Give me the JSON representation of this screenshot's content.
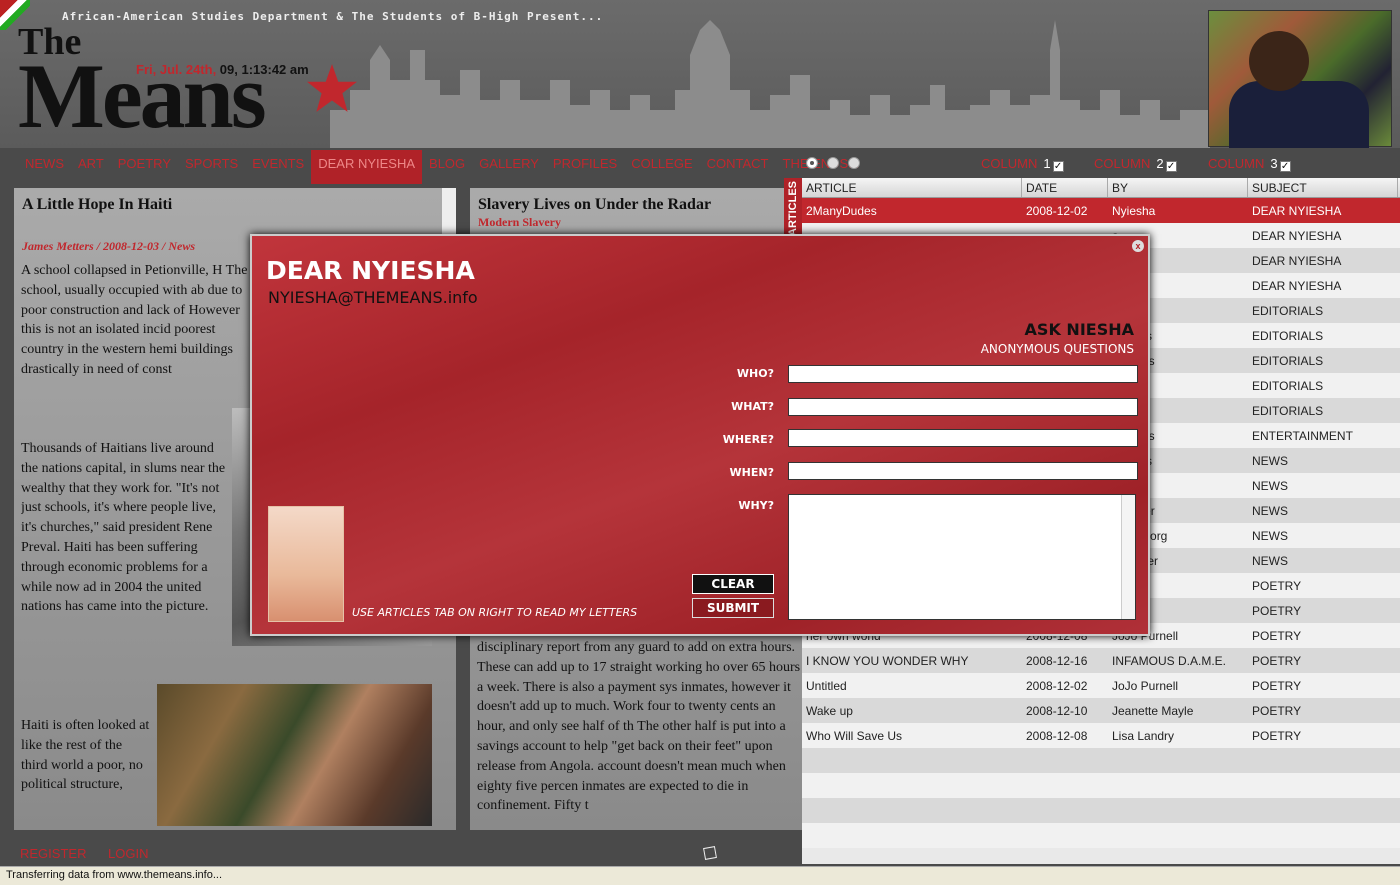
{
  "header": {
    "tagline": "African-American Studies Department & The Students of B-High Present...",
    "logo_the": "The",
    "logo_means": "Means",
    "date_red": "Fri, Jul. 24th,",
    "date_rest": " 09, 1:13:42 am"
  },
  "nav": {
    "items": [
      "NEWS",
      "ART",
      "POETRY",
      "SPORTS",
      "EVENTS",
      "DEAR NYIESHA",
      "BLOG",
      "GALLERY",
      "PROFILES",
      "COLLEGE",
      "CONTACT",
      "THE ENDS..."
    ],
    "columns": [
      {
        "label": "COLUMN",
        "num": "1"
      },
      {
        "label": "COLUMN",
        "num": "2"
      },
      {
        "label": "COLUMN",
        "num": "3"
      }
    ]
  },
  "article1": {
    "title": "A Little Hope In Haiti",
    "byline": "James Metters / 2008-12-03 / News",
    "para1": "A school collapsed  in  Petionville, H The school, usually occupied with ab due to poor construction and lack of However this is not an isolated incid poorest country in the western hemi buildings drastically in need of const",
    "para2": "Thousands of Haitians live around the nations capital, in slums near the wealthy that they work for. \"It's not just schools, it's where people live, it's churches,\" said president Rene Preval. Haiti has been suffering through economic problems for a while now ad in 2004 the united nations has came into the picture.",
    "para3": "Haiti is often looked at like the rest of the third world a poor, no political structure,"
  },
  "article2": {
    "title": "Slavery Lives on Under the Radar",
    "subtitle": "Modern Slavery",
    "para": "disciplinary report from any guard to add on extra hours.  These can add up to 17 straight working ho over 65 hours a week.  There is also a payment sys inmates, however it doesn't add up to much.  Work four to twenty cents an hour, and only see half of th The other half is put into a savings account to help \"get back on their feet\" upon release from Angola. account doesn't mean much when eighty five percen inmates are expected to die in confinement.  Fifty t"
  },
  "table": {
    "side_tab": "ARTICLES",
    "headers": [
      "ARTICLE",
      "DATE",
      "BY",
      "SUBJECT"
    ],
    "rows": [
      [
        "2ManyDudes",
        "2008-12-02",
        "Nyiesha",
        "DEAR NYIESHA"
      ],
      [
        "",
        "",
        "a",
        "DEAR NYIESHA"
      ],
      [
        "",
        "",
        "a",
        "DEAR NYIESHA"
      ],
      [
        "",
        "",
        "a",
        "DEAR NYIESHA"
      ],
      [
        "",
        "",
        "Spivey",
        "EDITORIALS"
      ],
      [
        "",
        "",
        "metters",
        "EDITORIALS"
      ],
      [
        "",
        "",
        "Gilliams",
        "EDITORIALS"
      ],
      [
        "",
        "",
        "ith",
        "EDITORIALS"
      ],
      [
        "",
        "",
        "uyen",
        "EDITORIALS"
      ],
      [
        "",
        "",
        "Gilliams",
        "ENTERTAINMENT"
      ],
      [
        "",
        "",
        "Metters",
        "NEWS"
      ],
      [
        "",
        "",
        "na",
        "NEWS"
      ],
      [
        "",
        "",
        "Gaebler",
        "NEWS"
      ],
      [
        "",
        "",
        ". Ginsborg",
        "NEWS"
      ],
      [
        "",
        "",
        "a Tucker",
        "NEWS"
      ],
      [
        "",
        "",
        "rnell",
        "POETRY"
      ],
      [
        "",
        "",
        "Allen",
        "POETRY"
      ],
      [
        "her own world",
        "2008-12-08",
        "JoJo Purnell",
        "POETRY"
      ],
      [
        "I KNOW YOU WONDER WHY",
        "2008-12-16",
        "INFAMOUS D.A.M.E.",
        "POETRY"
      ],
      [
        "Untitled",
        "2008-12-02",
        "JoJo Purnell",
        "POETRY"
      ],
      [
        "Wake up",
        "2008-12-10",
        "Jeanette Mayle",
        "POETRY"
      ],
      [
        "Who Will Save Us",
        "2008-12-08",
        "Lisa Landry",
        "POETRY"
      ],
      [
        "",
        "",
        "",
        ""
      ],
      [
        "",
        "",
        "",
        ""
      ],
      [
        "",
        "",
        "",
        ""
      ],
      [
        "",
        "",
        "",
        ""
      ]
    ]
  },
  "modal": {
    "title": "DEAR NYIESHA",
    "email": "NYIESHA@THEMEANS.info",
    "ask": "ASK NIESHA",
    "anon": "ANONYMOUS QUESTIONS",
    "labels": [
      "WHO?",
      "WHAT?",
      "WHERE?",
      "WHEN?",
      "WHY?"
    ],
    "clear": "CLEAR",
    "submit": "SUBMIT",
    "hint": "USE ARTICLES TAB ON RIGHT TO READ MY LETTERS",
    "close": "x"
  },
  "footer": {
    "register": "REGISTER",
    "login": "LOGIN",
    "status": "Transferring data from www.themeans.info..."
  }
}
